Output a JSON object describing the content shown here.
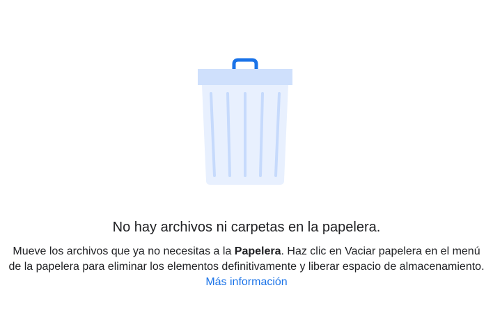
{
  "empty_state": {
    "illustration": "trash-can-icon",
    "title": "No hay archivos ni carpetas en la papelera.",
    "description_part1": "Mueve los archivos que ya no necesitas a la ",
    "description_bold": "Papelera",
    "description_part2": ". Haz clic en Vaciar papelera en el menú de la papelera para eliminar los elementos definitivamente y liberar espacio de almacenamiento. ",
    "learn_more_link": "Más información"
  },
  "colors": {
    "text_primary": "#202124",
    "link": "#1a73e8",
    "illustration_lid": "#cfe0fc",
    "illustration_body": "#e8f0fe",
    "illustration_handle": "#1a73e8",
    "illustration_stripes": "#c6dafc"
  }
}
